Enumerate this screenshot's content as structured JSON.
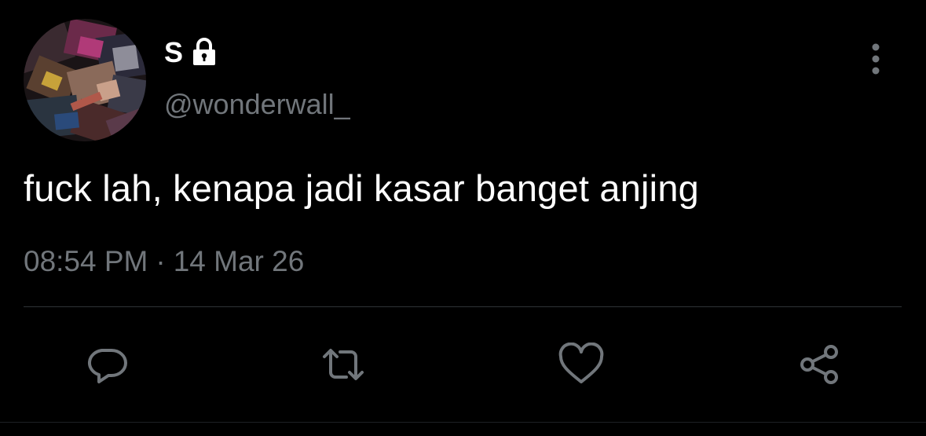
{
  "tweet": {
    "display_name": "S",
    "handle": "@wonderwall_",
    "text": "fuck lah, kenapa jadi kasar banget anjing",
    "time": "08:54 PM",
    "separator": "·",
    "date": "14 Mar 26"
  },
  "icons": {
    "lock": "lock-icon",
    "more": "more-vertical-icon",
    "reply": "reply-bubble-icon",
    "retweet": "retweet-icon",
    "like": "heart-icon",
    "share": "share-icon"
  },
  "colors": {
    "background": "#000000",
    "text_primary": "#ffffff",
    "text_secondary": "#71767b",
    "divider": "#2f3336"
  }
}
